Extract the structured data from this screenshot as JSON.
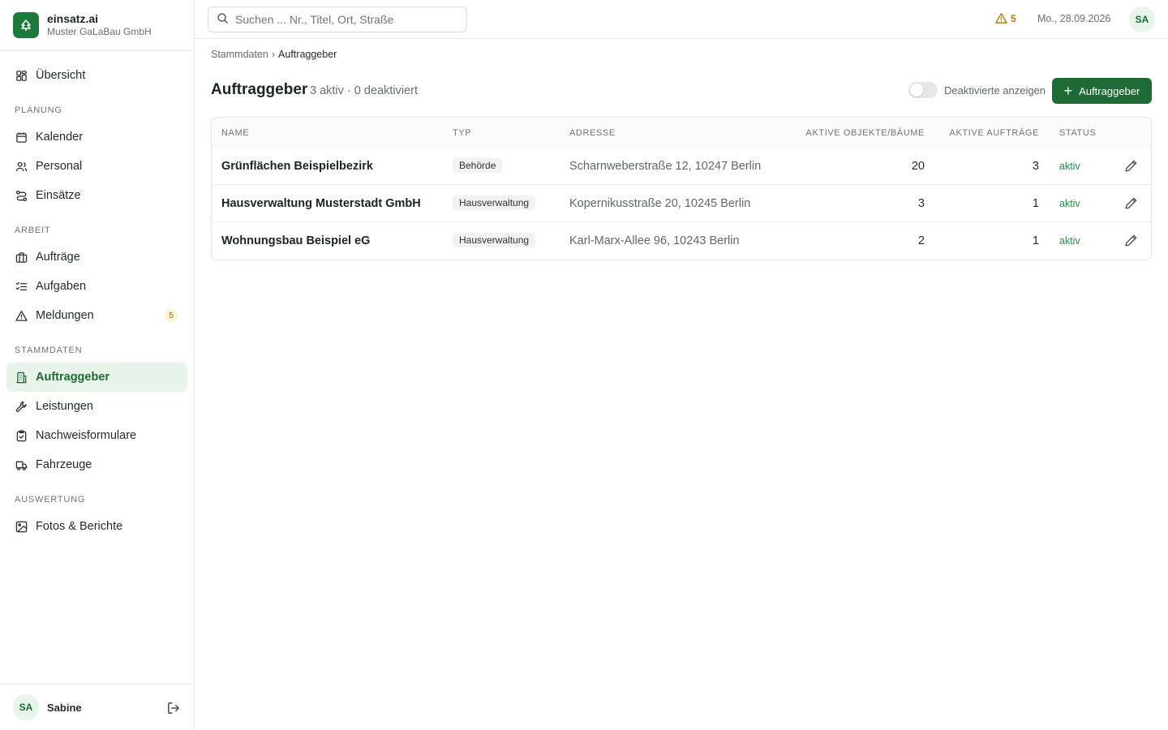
{
  "brand": {
    "name": "einsatz.ai",
    "company": "Muster GaLaBau GmbH"
  },
  "nav": {
    "overview": "Übersicht",
    "sections": {
      "planung": "PLANUNG",
      "arbeit": "ARBEIT",
      "stammdaten": "STAMMDATEN",
      "auswertung": "AUSWERTUNG"
    },
    "items": {
      "kalender": "Kalender",
      "personal": "Personal",
      "einsaetze": "Einsätze",
      "auftraege": "Aufträge",
      "aufgaben": "Aufgaben",
      "meldungen": "Meldungen",
      "meldungen_badge": "5",
      "auftraggeber": "Auftraggeber",
      "leistungen": "Leistungen",
      "nachweisformulare": "Nachweisformulare",
      "fahrzeuge": "Fahrzeuge",
      "fotos": "Fotos & Berichte"
    }
  },
  "user": {
    "initials": "SA",
    "name": "Sabine"
  },
  "topbar": {
    "search_placeholder": "Suchen ... Nr., Titel, Ort, Straße",
    "alert_count": "5",
    "date": "Mo., 28.09.2026",
    "avatar": "SA"
  },
  "breadcrumb": {
    "parent": "Stammdaten",
    "separator": "›",
    "current": "Auftraggeber"
  },
  "page": {
    "title": "Auftraggeber",
    "subtitle": "3 aktiv · 0 deaktiviert",
    "toggle_label": "Deaktivierte anzeigen",
    "add_button": "Auftraggeber"
  },
  "table": {
    "headers": {
      "name": "NAME",
      "typ": "TYP",
      "adresse": "ADRESSE",
      "objekte": "AKTIVE OBJEKTE/BÄUME",
      "auftraege": "AKTIVE AUFTRÄGE",
      "status": "STATUS"
    },
    "rows": [
      {
        "name": "Grünflächen Beispielbezirk",
        "typ": "Behörde",
        "adresse": "Scharnweberstraße 12, 10247 Berlin",
        "objekte": "20",
        "auftraege": "3",
        "status": "aktiv"
      },
      {
        "name": "Hausverwaltung Musterstadt GmbH",
        "typ": "Hausverwaltung",
        "adresse": "Kopernikusstraße 20, 10245 Berlin",
        "objekte": "3",
        "auftraege": "1",
        "status": "aktiv"
      },
      {
        "name": "Wohnungsbau Beispiel eG",
        "typ": "Hausverwaltung",
        "adresse": "Karl-Marx-Allee 96, 10243 Berlin",
        "objekte": "2",
        "auftraege": "1",
        "status": "aktiv"
      }
    ]
  },
  "colors": {
    "accent": "#1e6b35",
    "status_active": "#2f8a45",
    "warning": "#b77a00"
  }
}
